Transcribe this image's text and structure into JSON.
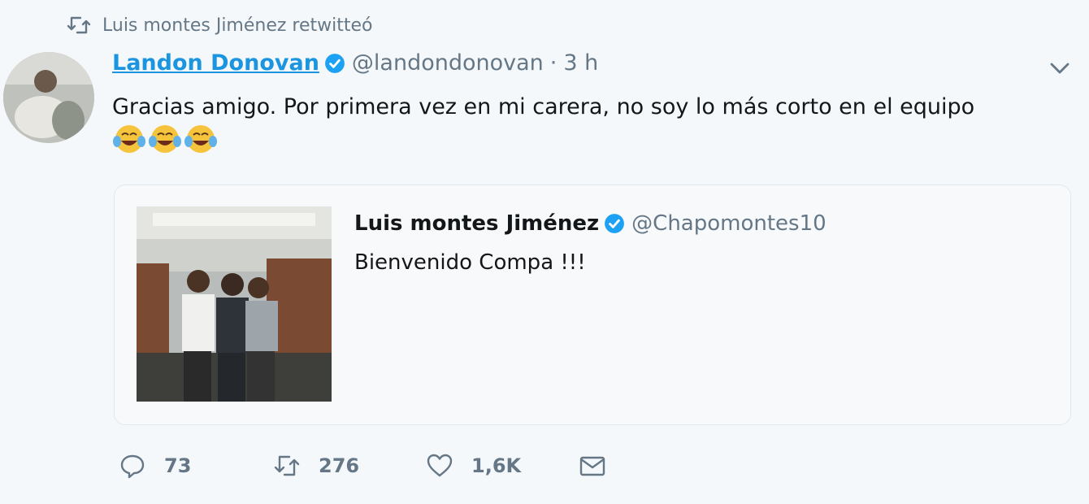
{
  "retweet": {
    "label": "Luis montes Jiménez retwitteó"
  },
  "tweet": {
    "author_name": "Landon Donovan",
    "author_handle": "@landondonovan",
    "separator": "·",
    "time": "3 h",
    "text": "Gracias amigo.  Por primera vez en mi carera, no soy lo más corto en el equipo",
    "emojis": [
      "😂",
      "😂",
      "😂"
    ]
  },
  "quoted": {
    "author_name": "Luis montes Jiménez",
    "author_handle": "@Chapomontes10",
    "text": "Bienvenido Compa !!!"
  },
  "actions": {
    "reply_count": "73",
    "retweet_count": "276",
    "like_count": "1,6K"
  },
  "colors": {
    "link_blue": "#1b95e0",
    "muted_gray": "#657786",
    "verified_blue": "#1da1f2",
    "background": "#f5f8fa"
  },
  "icons": [
    "retweet-icon",
    "verified-icon",
    "chevron-down-icon",
    "reply-icon",
    "like-icon",
    "message-icon"
  ]
}
